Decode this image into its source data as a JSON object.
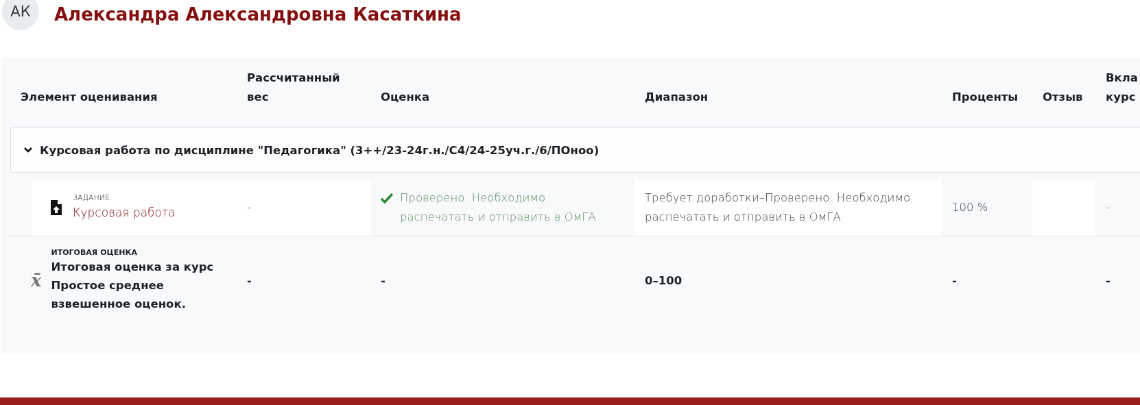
{
  "user": {
    "initials": "АК",
    "name": "Александра Александровна Касаткина"
  },
  "table": {
    "columns": [
      "Элемент оценивания",
      "Рассчитанный вес",
      "Оценка",
      "Диапазон",
      "Проценты",
      "Отзыв",
      "Вкла курс"
    ],
    "category": {
      "title": "Курсовая работа по дисциплине \"Педагогика\" (3++/23-24г.н./С4/24-25уч.г./6/ПОноо)",
      "expanded": true
    },
    "rows": [
      {
        "kind": "item",
        "type_label": "ЗАДАНИЕ",
        "name": "Курсовая работа",
        "weight": "-",
        "grade": "Проверено. Необходимо распечатать и отправить в ОмГА",
        "graded": true,
        "range": "Требует доработки–Проверено. Необходимо распечатать и отправить в ОмГА",
        "percent": "100 %",
        "contribution": "-"
      },
      {
        "kind": "total",
        "icon": "x̄",
        "type_label": "ИТОГОВАЯ ОЦЕНКА",
        "name": "Итоговая оценка за курс",
        "subtitle": "Простое среднее взвешенное оценок.",
        "weight": "-",
        "grade": "-",
        "range": "0–100",
        "percent": "-",
        "contribution": "-"
      }
    ]
  }
}
